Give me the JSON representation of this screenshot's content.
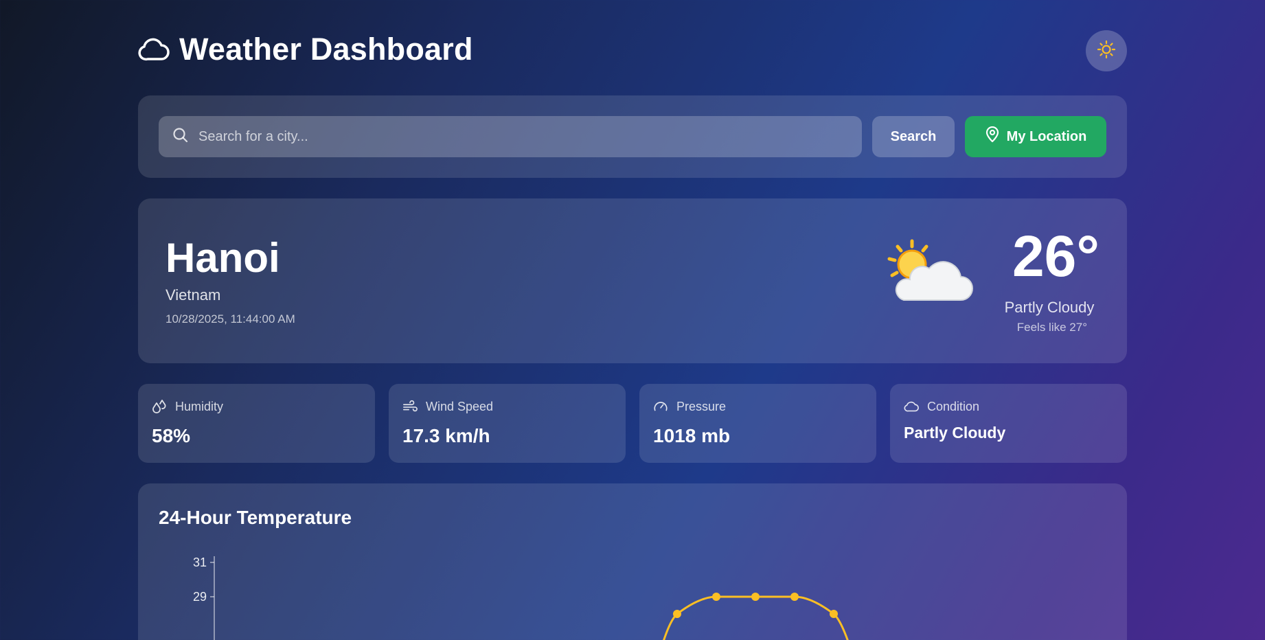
{
  "header": {
    "title": "Weather Dashboard",
    "logo_icon": "cloud-icon",
    "theme_toggle_icon": "sun-icon"
  },
  "search": {
    "placeholder": "Search for a city...",
    "search_label": "Search",
    "location_label": "My Location",
    "location_color": "#22a862"
  },
  "current": {
    "city": "Hanoi",
    "country": "Vietnam",
    "datetime": "10/28/2025, 11:44:00 AM",
    "temperature": "26°",
    "condition": "Partly Cloudy",
    "feels_like": "Feels like 27°",
    "icon": "partly-cloudy-icon"
  },
  "stats": [
    {
      "label": "Humidity",
      "value": "58%",
      "icon": "droplets-icon"
    },
    {
      "label": "Wind Speed",
      "value": "17.3 km/h",
      "icon": "wind-icon"
    },
    {
      "label": "Pressure",
      "value": "1018 mb",
      "icon": "gauge-icon"
    },
    {
      "label": "Condition",
      "value": "Partly Cloudy",
      "icon": "cloud-icon"
    }
  ],
  "chart": {
    "title": "24-Hour Temperature"
  },
  "chart_data": {
    "type": "line",
    "title": "24-Hour Temperature",
    "xlabel": "",
    "ylabel": "",
    "y_ticks": [
      "31",
      "29"
    ],
    "ylim_visible": [
      28,
      31
    ],
    "series": [
      {
        "values": [
          28,
          29,
          29,
          29,
          28
        ]
      }
    ],
    "line_color": "#fbbf24",
    "grid": false
  }
}
